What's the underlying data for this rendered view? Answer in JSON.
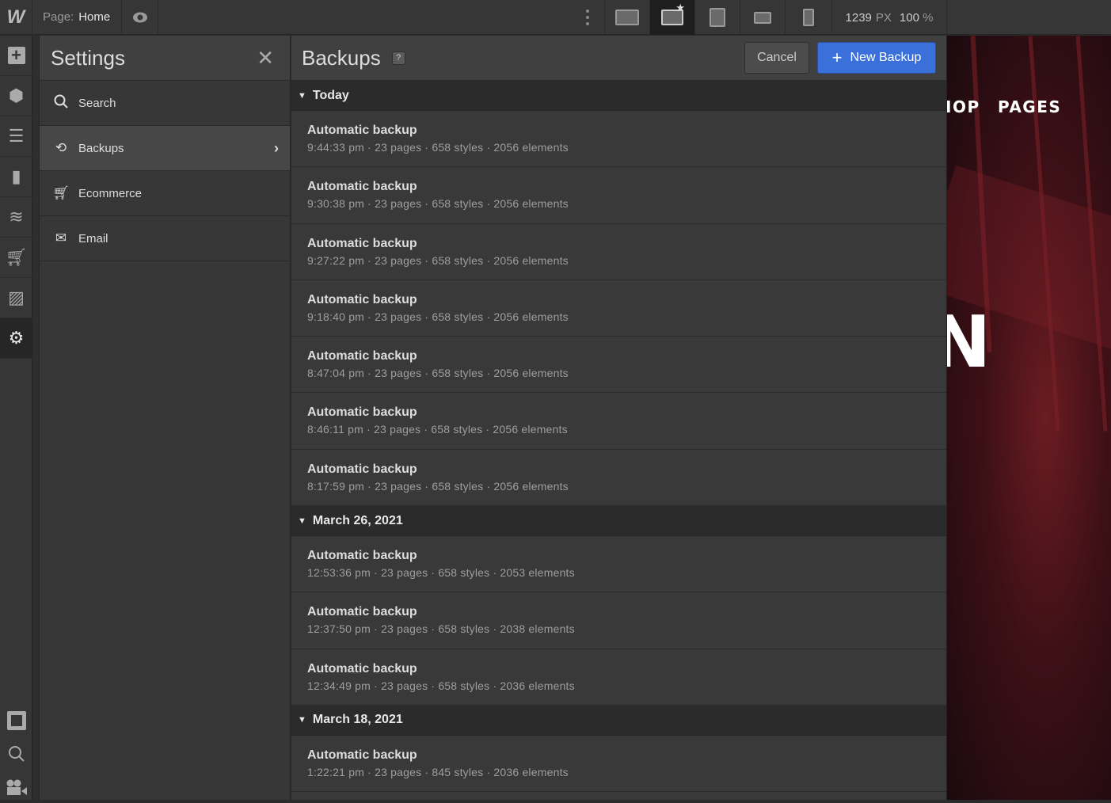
{
  "topbar": {
    "logo": "W",
    "page_label": "Page:",
    "page_name": "Home",
    "width": "1239",
    "width_unit": "PX",
    "zoom": "100",
    "zoom_unit": "%"
  },
  "settings": {
    "title": "Settings",
    "items": [
      {
        "label": "Search",
        "icon": "search-icon"
      },
      {
        "label": "Backups",
        "icon": "history-icon"
      },
      {
        "label": "Ecommerce",
        "icon": "cart-icon"
      },
      {
        "label": "Email",
        "icon": "mail-icon"
      }
    ]
  },
  "backups": {
    "title": "Backups",
    "help": "?",
    "cancel": "Cancel",
    "new_backup": "New Backup",
    "groups": [
      {
        "label": "Today",
        "rows": [
          {
            "name": "Automatic backup",
            "meta": "9:44:33 pm · 23 pages · 658 styles · 2056 elements"
          },
          {
            "name": "Automatic backup",
            "meta": "9:30:38 pm · 23 pages · 658 styles · 2056 elements"
          },
          {
            "name": "Automatic backup",
            "meta": "9:27:22 pm · 23 pages · 658 styles · 2056 elements"
          },
          {
            "name": "Automatic backup",
            "meta": "9:18:40 pm · 23 pages · 658 styles · 2056 elements"
          },
          {
            "name": "Automatic backup",
            "meta": "8:47:04 pm · 23 pages · 658 styles · 2056 elements"
          },
          {
            "name": "Automatic backup",
            "meta": "8:46:11 pm · 23 pages · 658 styles · 2056 elements"
          },
          {
            "name": "Automatic backup",
            "meta": "8:17:59 pm · 23 pages · 658 styles · 2056 elements"
          }
        ]
      },
      {
        "label": "March 26, 2021",
        "rows": [
          {
            "name": "Automatic backup",
            "meta": "12:53:36 pm · 23 pages · 658 styles · 2053 elements"
          },
          {
            "name": "Automatic backup",
            "meta": "12:37:50 pm · 23 pages · 658 styles · 2038 elements"
          },
          {
            "name": "Automatic backup",
            "meta": "12:34:49 pm · 23 pages · 658 styles · 2036 elements"
          }
        ]
      },
      {
        "label": "March 18, 2021",
        "rows": [
          {
            "name": "Automatic backup",
            "meta": "1:22:21 pm · 23 pages · 845 styles · 2036 elements"
          }
        ]
      }
    ]
  },
  "canvas": {
    "nav_partial": "IOP",
    "nav_pages": "PAGES",
    "hero_partial": "N"
  },
  "colors": {
    "accent": "#3b6fd9"
  }
}
